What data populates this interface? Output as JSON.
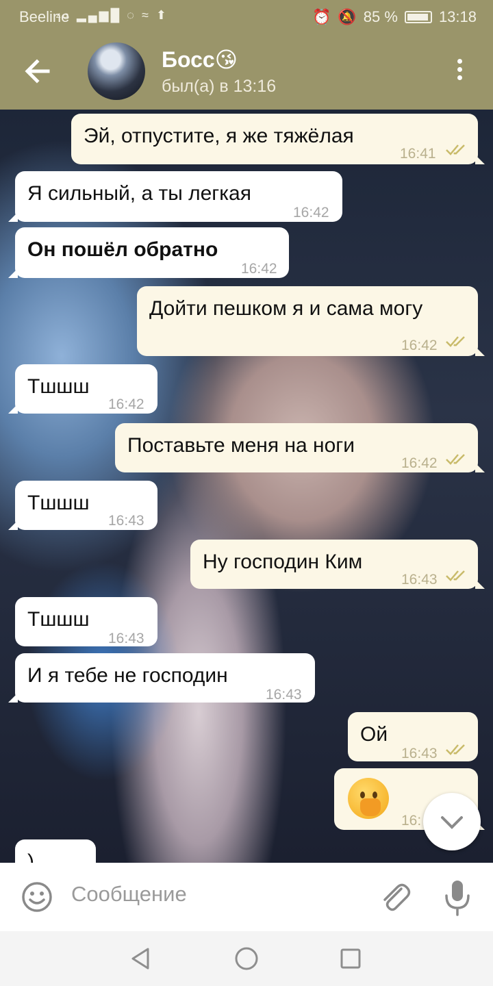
{
  "status_bar": {
    "carrier": "Beeline",
    "network": "4G",
    "battery": "85 %",
    "battery_level": 0.85,
    "time": "13:18"
  },
  "header": {
    "title": "Босс😘",
    "subtitle": "был(а) в 13:16"
  },
  "messages": [
    {
      "dir": "out",
      "text": "Эй, отпустите, я же тяжёлая",
      "time": "16:41",
      "read": true
    },
    {
      "dir": "in",
      "text": "Я сильный, а ты легкая",
      "time": "16:42"
    },
    {
      "dir": "in",
      "text": "Он пошёл обратно",
      "time": "16:42"
    },
    {
      "dir": "out",
      "text": "Дойти пешком я и сама могу",
      "time": "16:42",
      "read": true
    },
    {
      "dir": "in",
      "text": "Тшшш",
      "time": "16:42"
    },
    {
      "dir": "out",
      "text": "Поставьте меня на ноги",
      "time": "16:42",
      "read": true
    },
    {
      "dir": "in",
      "text": "Тшшш",
      "time": "16:43"
    },
    {
      "dir": "out",
      "text": "Ну господин Ким",
      "time": "16:43",
      "read": true
    },
    {
      "dir": "in",
      "text": "Тшшш",
      "time": "16:43"
    },
    {
      "dir": "in",
      "text": "И я тебе не господин",
      "time": "16:43"
    },
    {
      "dir": "out",
      "text": "Ой",
      "time": "16:43",
      "read": true
    },
    {
      "dir": "out",
      "emoji": "face-with-hand-over-mouth",
      "time": "16:"
    },
    {
      "dir": "in",
      "text": ")"
    }
  ],
  "input": {
    "placeholder": "Сообщение"
  },
  "colors": {
    "header": "#9a956a",
    "bubble_in": "#ffffff",
    "bubble_out": "#fcf7e6",
    "check": "#c9bb6a"
  }
}
